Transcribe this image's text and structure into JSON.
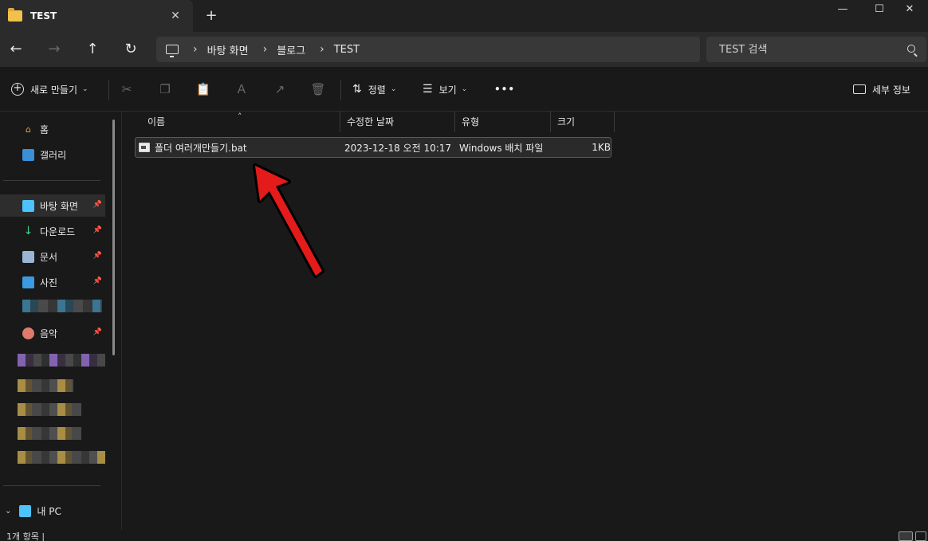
{
  "window": {
    "tab_title": "TEST",
    "tab_close": "✕",
    "new_tab": "+",
    "minimize": "—",
    "maximize": "☐",
    "close": "✕"
  },
  "nav": {
    "back": "←",
    "forward": "→",
    "up": "↑",
    "refresh": "↻",
    "breadcrumbs": [
      "바탕 화면",
      "블로그",
      "TEST"
    ],
    "search_placeholder": "TEST 검색"
  },
  "command_bar": {
    "new_label": "새로 만들기",
    "sort_label": "정렬",
    "view_label": "보기",
    "more": "•••",
    "details_label": "세부 정보"
  },
  "sidebar": {
    "home": "홈",
    "gallery": "갤러리",
    "pinned": [
      {
        "label": "바탕 화면",
        "icon": "desktop-icon"
      },
      {
        "label": "다운로드",
        "icon": "download-icon"
      },
      {
        "label": "문서",
        "icon": "document-icon"
      },
      {
        "label": "사진",
        "icon": "picture-icon"
      },
      {
        "label": "음악",
        "icon": "music-icon"
      }
    ],
    "this_pc": "내 PC",
    "pin_glyph": "📌"
  },
  "file_list": {
    "columns": [
      "이름",
      "수정한 날짜",
      "유형",
      "크기"
    ],
    "rows": [
      {
        "name": "폴더 여러개만들기.bat",
        "modified": "2023-12-18 오전 10:17",
        "type": "Windows 배치 파일",
        "size": "1KB"
      }
    ]
  },
  "status": {
    "text": "1개 항목 |"
  },
  "colors": {
    "annotation_arrow": "#e31b1b",
    "folder": "#f2c14d",
    "accent": "#4cc2ff"
  }
}
